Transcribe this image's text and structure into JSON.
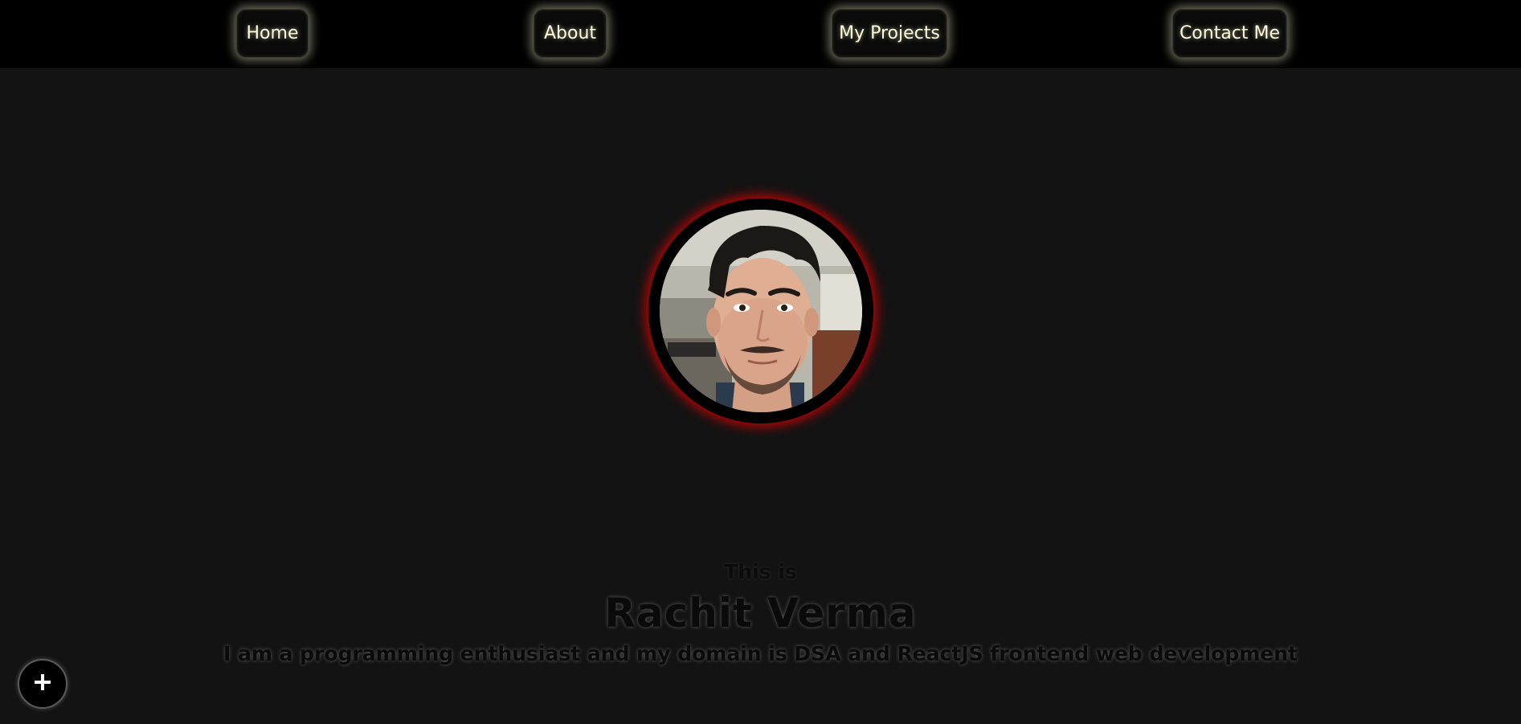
{
  "nav": {
    "items": [
      {
        "label": "Home"
      },
      {
        "label": "About"
      },
      {
        "label": "My Projects"
      },
      {
        "label": "Contact Me"
      }
    ]
  },
  "hero": {
    "intro": "This is",
    "name": "Rachit Verma",
    "tagline": "I am a programming enthusiast and my domain is DSA and ReactJS frontend web development"
  },
  "fab": {
    "icon": "plus-icon"
  },
  "colors": {
    "page_bg": "#131313",
    "navbar_bg": "#000000",
    "nav_text": "#fffbe0",
    "avatar_glow": "#dc0000"
  }
}
